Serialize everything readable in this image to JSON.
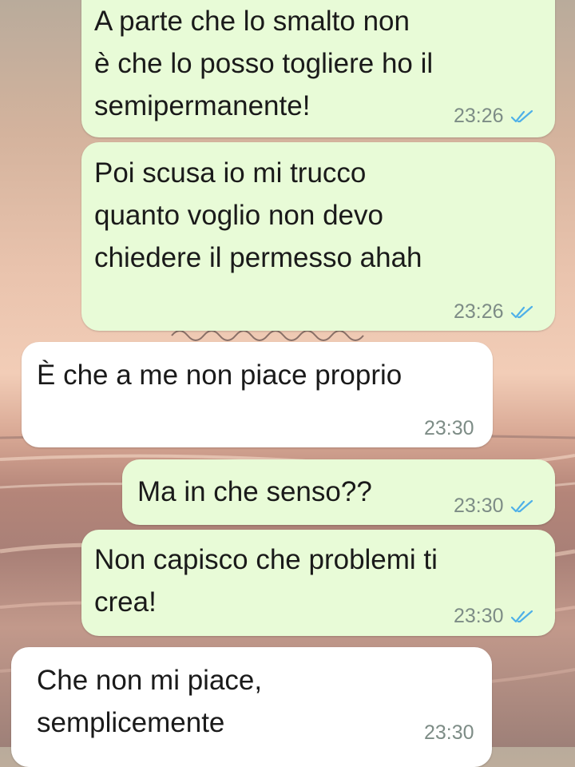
{
  "messages": [
    {
      "direction": "out",
      "text": "A parte che lo smalto non\nè che lo posso togliere ho il\nsemipermanente!",
      "time": "23:26",
      "read": true
    },
    {
      "direction": "out",
      "text": "Poi scusa io mi trucco\nquanto voglio non devo\nchiedere il permesso ahah",
      "time": "23:26",
      "read": true
    },
    {
      "direction": "in",
      "text": "È che a me non piace proprio",
      "time": "23:30"
    },
    {
      "direction": "out",
      "text": "Ma in che senso??",
      "time": "23:30",
      "read": true
    },
    {
      "direction": "out",
      "text": "Non capisco che problemi ti\ncrea!",
      "time": "23:30",
      "read": true
    },
    {
      "direction": "in",
      "text": "Che non mi piace,\nsemplicemente",
      "time": "23:30"
    }
  ],
  "colors": {
    "outgoing_bubble": "#e8fbd7",
    "incoming_bubble": "#ffffff",
    "read_ticks": "#4fb0e8",
    "timestamp": "#7d8c86"
  },
  "icons": {
    "read_receipt": "double-check-icon"
  }
}
